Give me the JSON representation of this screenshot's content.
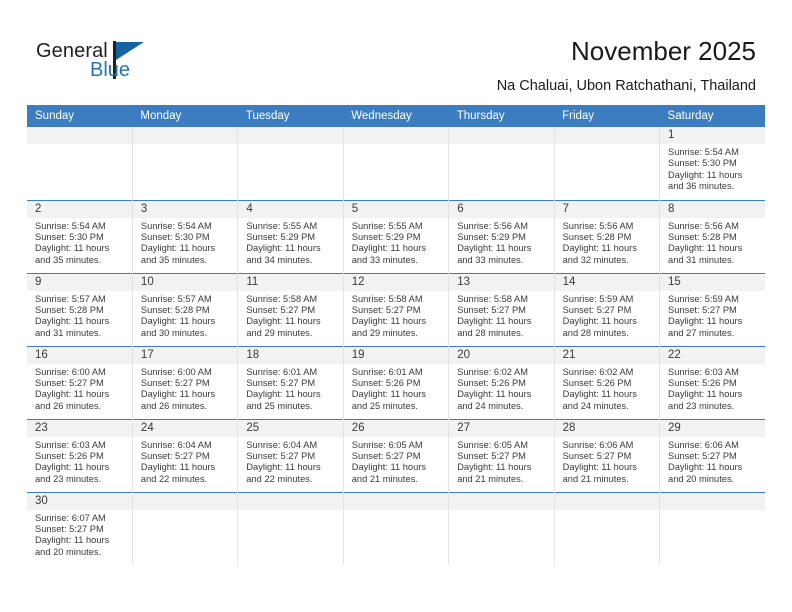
{
  "brand": {
    "line1": "General",
    "line2": "Blue",
    "accent_color": "#2176bd",
    "flag_color": "#1464a5"
  },
  "header": {
    "title": "November 2025",
    "location": "Na Chaluai, Ubon Ratchathani, Thailand",
    "header_bg": "#3b7dc0"
  },
  "weekdays": [
    "Sunday",
    "Monday",
    "Tuesday",
    "Wednesday",
    "Thursday",
    "Friday",
    "Saturday"
  ],
  "weeks": [
    [
      {
        "day": "",
        "empty": true
      },
      {
        "day": "",
        "empty": true
      },
      {
        "day": "",
        "empty": true
      },
      {
        "day": "",
        "empty": true
      },
      {
        "day": "",
        "empty": true
      },
      {
        "day": "",
        "empty": true
      },
      {
        "day": "1",
        "sunrise": "Sunrise: 5:54 AM",
        "sunset": "Sunset: 5:30 PM",
        "daylight1": "Daylight: 11 hours",
        "daylight2": "and 36 minutes."
      }
    ],
    [
      {
        "day": "2",
        "sunrise": "Sunrise: 5:54 AM",
        "sunset": "Sunset: 5:30 PM",
        "daylight1": "Daylight: 11 hours",
        "daylight2": "and 35 minutes."
      },
      {
        "day": "3",
        "sunrise": "Sunrise: 5:54 AM",
        "sunset": "Sunset: 5:30 PM",
        "daylight1": "Daylight: 11 hours",
        "daylight2": "and 35 minutes."
      },
      {
        "day": "4",
        "sunrise": "Sunrise: 5:55 AM",
        "sunset": "Sunset: 5:29 PM",
        "daylight1": "Daylight: 11 hours",
        "daylight2": "and 34 minutes."
      },
      {
        "day": "5",
        "sunrise": "Sunrise: 5:55 AM",
        "sunset": "Sunset: 5:29 PM",
        "daylight1": "Daylight: 11 hours",
        "daylight2": "and 33 minutes."
      },
      {
        "day": "6",
        "sunrise": "Sunrise: 5:56 AM",
        "sunset": "Sunset: 5:29 PM",
        "daylight1": "Daylight: 11 hours",
        "daylight2": "and 33 minutes."
      },
      {
        "day": "7",
        "sunrise": "Sunrise: 5:56 AM",
        "sunset": "Sunset: 5:28 PM",
        "daylight1": "Daylight: 11 hours",
        "daylight2": "and 32 minutes."
      },
      {
        "day": "8",
        "sunrise": "Sunrise: 5:56 AM",
        "sunset": "Sunset: 5:28 PM",
        "daylight1": "Daylight: 11 hours",
        "daylight2": "and 31 minutes."
      }
    ],
    [
      {
        "day": "9",
        "sunrise": "Sunrise: 5:57 AM",
        "sunset": "Sunset: 5:28 PM",
        "daylight1": "Daylight: 11 hours",
        "daylight2": "and 31 minutes."
      },
      {
        "day": "10",
        "sunrise": "Sunrise: 5:57 AM",
        "sunset": "Sunset: 5:28 PM",
        "daylight1": "Daylight: 11 hours",
        "daylight2": "and 30 minutes."
      },
      {
        "day": "11",
        "sunrise": "Sunrise: 5:58 AM",
        "sunset": "Sunset: 5:27 PM",
        "daylight1": "Daylight: 11 hours",
        "daylight2": "and 29 minutes."
      },
      {
        "day": "12",
        "sunrise": "Sunrise: 5:58 AM",
        "sunset": "Sunset: 5:27 PM",
        "daylight1": "Daylight: 11 hours",
        "daylight2": "and 29 minutes."
      },
      {
        "day": "13",
        "sunrise": "Sunrise: 5:58 AM",
        "sunset": "Sunset: 5:27 PM",
        "daylight1": "Daylight: 11 hours",
        "daylight2": "and 28 minutes."
      },
      {
        "day": "14",
        "sunrise": "Sunrise: 5:59 AM",
        "sunset": "Sunset: 5:27 PM",
        "daylight1": "Daylight: 11 hours",
        "daylight2": "and 28 minutes."
      },
      {
        "day": "15",
        "sunrise": "Sunrise: 5:59 AM",
        "sunset": "Sunset: 5:27 PM",
        "daylight1": "Daylight: 11 hours",
        "daylight2": "and 27 minutes."
      }
    ],
    [
      {
        "day": "16",
        "sunrise": "Sunrise: 6:00 AM",
        "sunset": "Sunset: 5:27 PM",
        "daylight1": "Daylight: 11 hours",
        "daylight2": "and 26 minutes."
      },
      {
        "day": "17",
        "sunrise": "Sunrise: 6:00 AM",
        "sunset": "Sunset: 5:27 PM",
        "daylight1": "Daylight: 11 hours",
        "daylight2": "and 26 minutes."
      },
      {
        "day": "18",
        "sunrise": "Sunrise: 6:01 AM",
        "sunset": "Sunset: 5:27 PM",
        "daylight1": "Daylight: 11 hours",
        "daylight2": "and 25 minutes."
      },
      {
        "day": "19",
        "sunrise": "Sunrise: 6:01 AM",
        "sunset": "Sunset: 5:26 PM",
        "daylight1": "Daylight: 11 hours",
        "daylight2": "and 25 minutes."
      },
      {
        "day": "20",
        "sunrise": "Sunrise: 6:02 AM",
        "sunset": "Sunset: 5:26 PM",
        "daylight1": "Daylight: 11 hours",
        "daylight2": "and 24 minutes."
      },
      {
        "day": "21",
        "sunrise": "Sunrise: 6:02 AM",
        "sunset": "Sunset: 5:26 PM",
        "daylight1": "Daylight: 11 hours",
        "daylight2": "and 24 minutes."
      },
      {
        "day": "22",
        "sunrise": "Sunrise: 6:03 AM",
        "sunset": "Sunset: 5:26 PM",
        "daylight1": "Daylight: 11 hours",
        "daylight2": "and 23 minutes."
      }
    ],
    [
      {
        "day": "23",
        "sunrise": "Sunrise: 6:03 AM",
        "sunset": "Sunset: 5:26 PM",
        "daylight1": "Daylight: 11 hours",
        "daylight2": "and 23 minutes."
      },
      {
        "day": "24",
        "sunrise": "Sunrise: 6:04 AM",
        "sunset": "Sunset: 5:27 PM",
        "daylight1": "Daylight: 11 hours",
        "daylight2": "and 22 minutes."
      },
      {
        "day": "25",
        "sunrise": "Sunrise: 6:04 AM",
        "sunset": "Sunset: 5:27 PM",
        "daylight1": "Daylight: 11 hours",
        "daylight2": "and 22 minutes."
      },
      {
        "day": "26",
        "sunrise": "Sunrise: 6:05 AM",
        "sunset": "Sunset: 5:27 PM",
        "daylight1": "Daylight: 11 hours",
        "daylight2": "and 21 minutes."
      },
      {
        "day": "27",
        "sunrise": "Sunrise: 6:05 AM",
        "sunset": "Sunset: 5:27 PM",
        "daylight1": "Daylight: 11 hours",
        "daylight2": "and 21 minutes."
      },
      {
        "day": "28",
        "sunrise": "Sunrise: 6:06 AM",
        "sunset": "Sunset: 5:27 PM",
        "daylight1": "Daylight: 11 hours",
        "daylight2": "and 21 minutes."
      },
      {
        "day": "29",
        "sunrise": "Sunrise: 6:06 AM",
        "sunset": "Sunset: 5:27 PM",
        "daylight1": "Daylight: 11 hours",
        "daylight2": "and 20 minutes."
      }
    ],
    [
      {
        "day": "30",
        "sunrise": "Sunrise: 6:07 AM",
        "sunset": "Sunset: 5:27 PM",
        "daylight1": "Daylight: 11 hours",
        "daylight2": "and 20 minutes."
      },
      {
        "day": "",
        "empty": true
      },
      {
        "day": "",
        "empty": true
      },
      {
        "day": "",
        "empty": true
      },
      {
        "day": "",
        "empty": true
      },
      {
        "day": "",
        "empty": true
      },
      {
        "day": "",
        "empty": true
      }
    ]
  ]
}
